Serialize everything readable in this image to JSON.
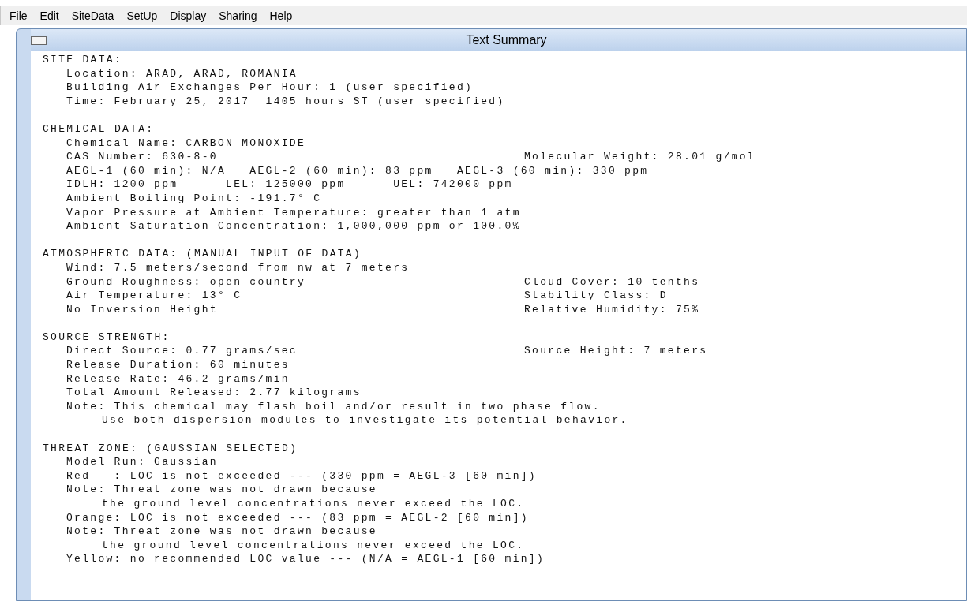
{
  "menu": [
    "File",
    "Edit",
    "SiteData",
    "SetUp",
    "Display",
    "Sharing",
    "Help"
  ],
  "window": {
    "title": "Text Summary"
  },
  "sections": [
    {
      "heading": "SITE DATA:",
      "lines": [
        {
          "text": "Location: ARAD, ARAD, ROMANIA"
        },
        {
          "text": "Building Air Exchanges Per Hour: 1 (user specified)"
        },
        {
          "text": "Time: February 25, 2017  1405 hours ST (user specified)"
        }
      ]
    },
    {
      "heading": "CHEMICAL DATA:",
      "lines": [
        {
          "text": "Chemical Name: CARBON MONOXIDE"
        },
        {
          "text": "CAS Number: 630-8-0",
          "right": "Molecular Weight: 28.01 g/mol"
        },
        {
          "text": "AEGL-1 (60 min): N/A   AEGL-2 (60 min): 83 ppm   AEGL-3 (60 min): 330 ppm"
        },
        {
          "text": "IDLH: 1200 ppm      LEL: 125000 ppm      UEL: 742000 ppm"
        },
        {
          "text": "Ambient Boiling Point: -191.7° C"
        },
        {
          "text": "Vapor Pressure at Ambient Temperature: greater than 1 atm"
        },
        {
          "text": "Ambient Saturation Concentration: 1,000,000 ppm or 100.0%"
        }
      ]
    },
    {
      "heading": "ATMOSPHERIC DATA: (MANUAL INPUT OF DATA)",
      "lines": [
        {
          "text": "Wind: 7.5 meters/second from nw at 7 meters"
        },
        {
          "text": "Ground Roughness: open country",
          "right": "Cloud Cover: 10 tenths"
        },
        {
          "text": "Air Temperature: 13° C",
          "right": "Stability Class: D"
        },
        {
          "text": "No Inversion Height",
          "right": "Relative Humidity: 75%"
        }
      ]
    },
    {
      "heading": "SOURCE STRENGTH:",
      "lines": [
        {
          "text": "Direct Source: 0.77 grams/sec",
          "right": "Source Height: 7 meters"
        },
        {
          "text": "Release Duration: 60 minutes"
        },
        {
          "text": "Release Rate: 46.2 grams/min"
        },
        {
          "text": "Total Amount Released: 2.77 kilograms"
        },
        {
          "text": "Note: This chemical may flash boil and/or result in two phase flow.",
          "children": [
            "Use both dispersion modules to investigate its potential behavior."
          ]
        }
      ]
    },
    {
      "heading": "THREAT ZONE: (GAUSSIAN SELECTED)",
      "lines": [
        {
          "text": "Model Run: Gaussian"
        },
        {
          "text": "Red   : LOC is not exceeded --- (330 ppm = AEGL-3 [60 min])"
        },
        {
          "text": "Note: Threat zone was not drawn because",
          "children": [
            "the ground level concentrations never exceed the LOC."
          ]
        },
        {
          "text": "Orange: LOC is not exceeded --- (83 ppm = AEGL-2 [60 min])"
        },
        {
          "text": "Note: Threat zone was not drawn because",
          "children": [
            "the ground level concentrations never exceed the LOC."
          ]
        },
        {
          "text": "Yellow: no recommended LOC value --- (N/A = AEGL-1 [60 min])"
        }
      ]
    }
  ]
}
